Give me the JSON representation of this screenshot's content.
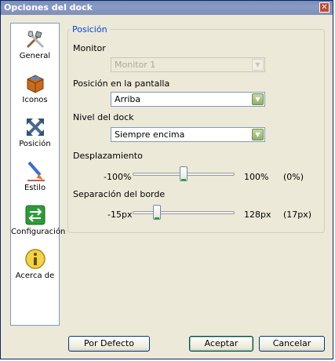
{
  "window": {
    "title": "Opciones del dock",
    "close_glyph": "✕"
  },
  "sidebar": {
    "items": [
      {
        "label": "General",
        "icon": "tools-icon",
        "selected": false
      },
      {
        "label": "Iconos",
        "icon": "package-icon",
        "selected": false
      },
      {
        "label": "Posición",
        "icon": "move-arrows-icon",
        "selected": true
      },
      {
        "label": "Estilo",
        "icon": "paintbrush-icon",
        "selected": false
      },
      {
        "label": "Configuración",
        "icon": "config-arrows-icon",
        "selected": false
      },
      {
        "label": "Acerca de",
        "icon": "info-icon",
        "selected": false
      }
    ]
  },
  "panel": {
    "legend": "Posición",
    "monitor": {
      "label": "Monitor",
      "value": "Monitor 1",
      "disabled": true
    },
    "position": {
      "label": "Posición en la pantalla",
      "value": "Arriba"
    },
    "level": {
      "label": "Nivel del dock",
      "value": "Siempre encima"
    },
    "offset": {
      "label": "Desplazamiento",
      "min": "-100%",
      "max": "100%",
      "current": "(0%)",
      "fraction": 0.5
    },
    "margin": {
      "label": "Separación del borde",
      "min": "-15px",
      "max": "128px",
      "current": "(17px)",
      "fraction": 0.22
    }
  },
  "buttons": {
    "default_label": "Por Defecto",
    "accept_label": "Aceptar",
    "cancel_label": "Cancelar"
  },
  "colors": {
    "legend": "#0046d5",
    "selected": "#316ac5",
    "title_bar": "#7f91b9"
  }
}
